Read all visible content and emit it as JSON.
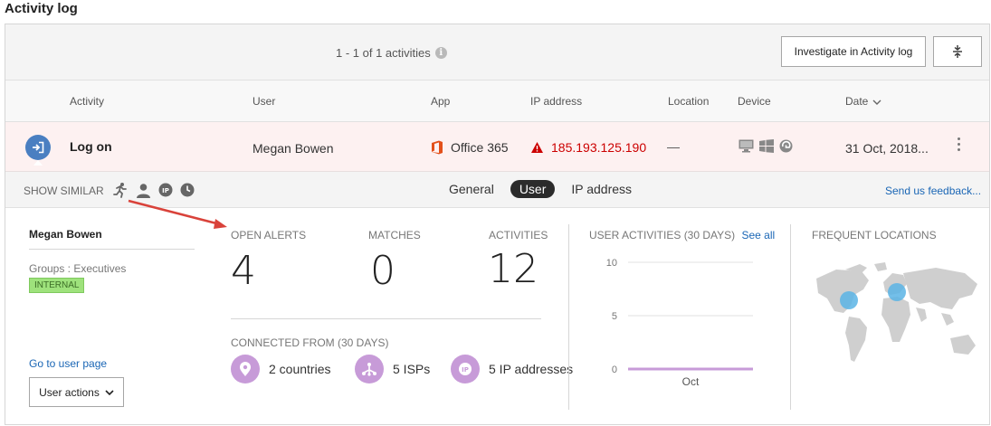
{
  "page": {
    "title": "Activity log"
  },
  "toolbar": {
    "count_text": "1 - 1 of 1 activities",
    "investigate_label": "Investigate in Activity log"
  },
  "table": {
    "columns": [
      "Activity",
      "User",
      "App",
      "IP address",
      "Location",
      "Device",
      "Date"
    ],
    "row": {
      "activity": "Log on",
      "user": "Megan Bowen",
      "app": "Office 365",
      "ip": "185.193.125.190",
      "location": "—",
      "date": "31 Oct, 2018..."
    }
  },
  "similar": {
    "label": "SHOW SIMILAR",
    "tabs": [
      "General",
      "User",
      "IP address"
    ],
    "active_tab": "User",
    "feedback": "Send us feedback..."
  },
  "user_panel": {
    "name": "Megan Bowen",
    "groups": "Groups : Executives",
    "badge": "INTERNAL",
    "goto": "Go to user page",
    "actions_label": "User actions"
  },
  "stats": {
    "open_alerts_label": "OPEN ALERTS",
    "open_alerts": "4",
    "matches_label": "MATCHES",
    "matches": "0",
    "activities_label": "ACTIVITIES",
    "activities": "12",
    "connected_label": "CONNECTED FROM (30 DAYS)",
    "countries": "2 countries",
    "isps": "5 ISPs",
    "ips": "5 IP addresses"
  },
  "user_activities": {
    "title": "USER ACTIVITIES (30 DAYS)",
    "see_all": "See all"
  },
  "frequent_locations": {
    "title": "FREQUENT LOCATIONS"
  },
  "chart_data": {
    "type": "line",
    "title": "",
    "categories": [
      "Oct"
    ],
    "series": [
      {
        "values": [
          0
        ]
      }
    ],
    "ylim": [
      0,
      10
    ],
    "yticks": [
      "10",
      "5",
      "0"
    ],
    "grid": true
  },
  "colors": {
    "accent": "#1a66b5",
    "alert_row": "#fdf1f1",
    "ip_red": "#cc0000",
    "badge_green": "#9ee27c",
    "icon_purple": "#c79bd8",
    "map_dot": "#5ab4e5",
    "chart_line": "#c79bd8"
  },
  "icons": {
    "activity": "sign-in-icon",
    "office": "office365-icon",
    "warning": "warning-icon",
    "devices": [
      "desktop-icon",
      "windows-icon",
      "browser-icon"
    ],
    "similar": [
      "runner-icon",
      "person-icon",
      "ip-icon",
      "clock-icon"
    ],
    "connected": [
      "location-pin-icon",
      "network-icon",
      "ip-icon"
    ]
  }
}
